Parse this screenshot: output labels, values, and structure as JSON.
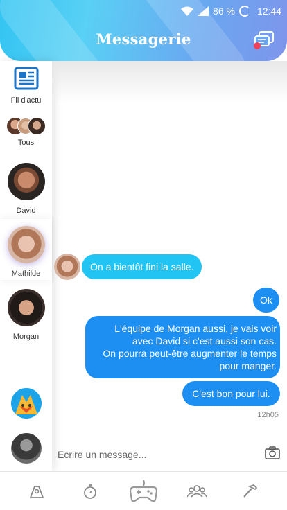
{
  "status_bar": {
    "battery": "86 %",
    "time": "12:44"
  },
  "header": {
    "title": "Messagerie"
  },
  "sidebar": {
    "items": [
      {
        "label": "Fil d'actu"
      },
      {
        "label": "Tous"
      },
      {
        "label": "David"
      },
      {
        "label": "Mathilde"
      },
      {
        "label": "Morgan"
      },
      {
        "label": ""
      },
      {
        "label": ""
      }
    ]
  },
  "messages": [
    {
      "direction": "in",
      "text": "On a bientôt fini la salle."
    },
    {
      "direction": "out",
      "text": "Ok"
    },
    {
      "direction": "out",
      "lines": [
        "L'équipe de Morgan aussi, je vais voir",
        "avec David si c'est aussi son cas.",
        "On pourra peut-être augmenter le temps",
        "pour manger."
      ]
    },
    {
      "direction": "out",
      "text": "C'est bon pour lui."
    }
  ],
  "last_time": "12h05",
  "composer": {
    "placeholder": "Ecrire un message..."
  },
  "colors": {
    "accent": "#21c4f3",
    "outgoing": "#1e8ff2",
    "header_start": "#33c4f2",
    "header_end": "#7e95ec"
  }
}
